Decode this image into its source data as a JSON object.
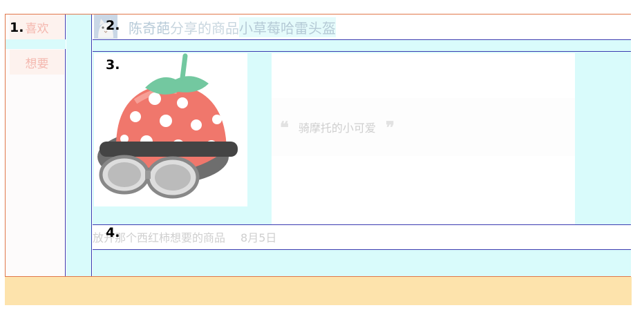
{
  "markers": [
    "1.",
    "2.",
    "3.",
    "4."
  ],
  "actions": {
    "like_label": "喜欢",
    "want_label": "想要"
  },
  "header": {
    "user": "陈奇葩",
    "shared_text": " 分享的商品 ",
    "product_name": "小草莓哈雷头盔"
  },
  "product": {
    "description": "骑摩托的小可爱",
    "quote_open": "❝",
    "quote_close": "❞"
  },
  "meta": {
    "text": "放开那个西红柿想要的商品",
    "date": "8月5日"
  },
  "colors": {
    "frame": "#e0774a",
    "divider": "#3a3ab0",
    "cyan": "#d9fbfb",
    "footer": "#fde3ac",
    "action_text": "#f4b7ae"
  },
  "icons": {
    "avatar": "cat-avatar-icon",
    "product_image": "strawberry-helmet-image"
  }
}
